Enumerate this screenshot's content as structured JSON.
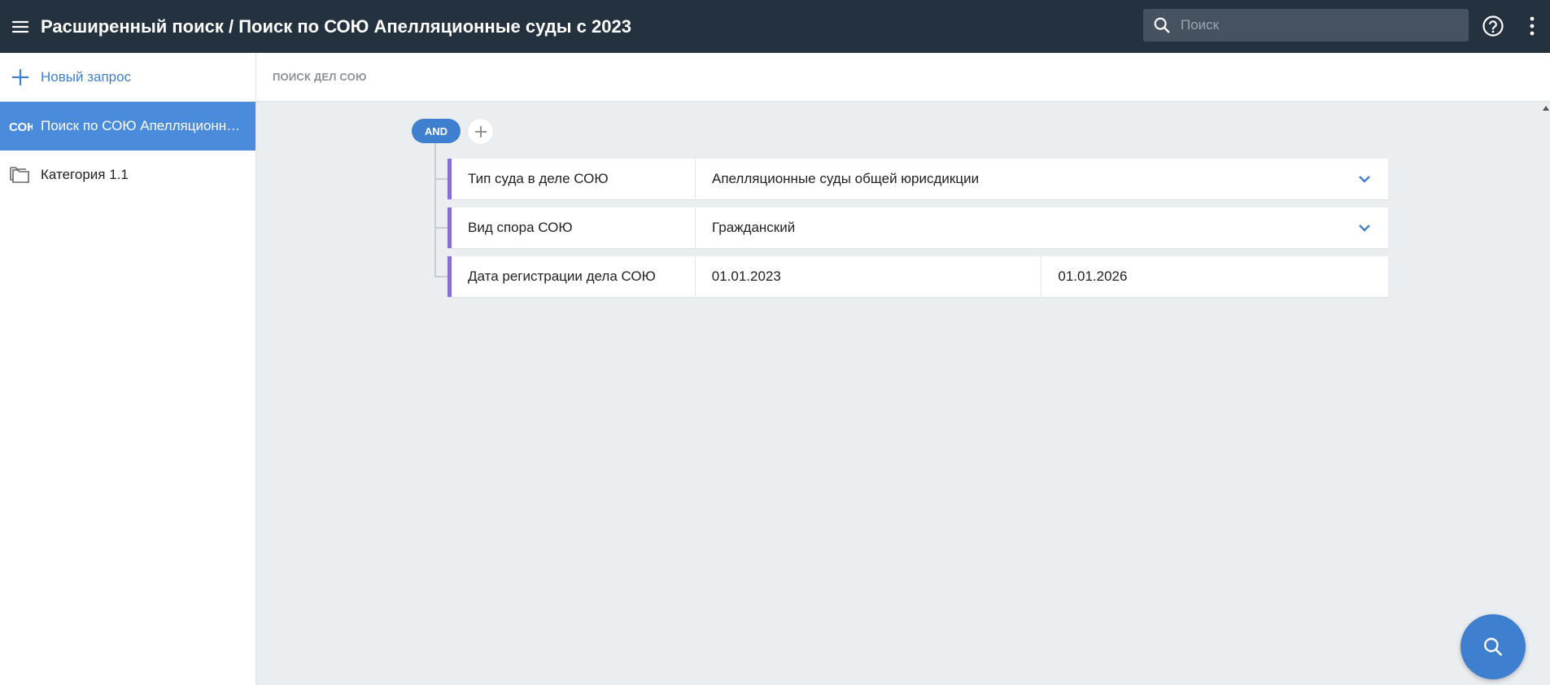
{
  "header": {
    "title": "Расширенный поиск / Поиск по СОЮ Апелляционные суды с 2023",
    "search_placeholder": "Поиск",
    "menu_icon": "hamburger-icon",
    "help_icon": "help-icon",
    "more_icon": "more-vertical-icon"
  },
  "sidebar": {
    "new_query_label": "Новый запрос",
    "items": [
      {
        "label": "Поиск по СОЮ Апелляционные суды с 2023",
        "icon": "soyu-badge-icon",
        "active": true
      },
      {
        "label": "Категория 1.1",
        "icon": "folder-icon",
        "active": false
      }
    ]
  },
  "subheader": {
    "label": "ПОИСК ДЕЛ СОЮ"
  },
  "query": {
    "operator": "AND",
    "conditions": [
      {
        "field": "Тип суда в деле СОЮ",
        "value": "Апелляционные суды общей юрисдикции"
      },
      {
        "field": "Вид спора СОЮ",
        "value": "Гражданский"
      },
      {
        "field": "Дата регистрации дела СОЮ",
        "from": "01.01.2023",
        "to": "01.01.2026"
      }
    ]
  },
  "colors": {
    "topbar": "#24313f",
    "accent": "#3f7fd0",
    "active_item": "#4a8bdb",
    "condition_marker": "#8a6ed6",
    "background": "#eaeef1"
  }
}
